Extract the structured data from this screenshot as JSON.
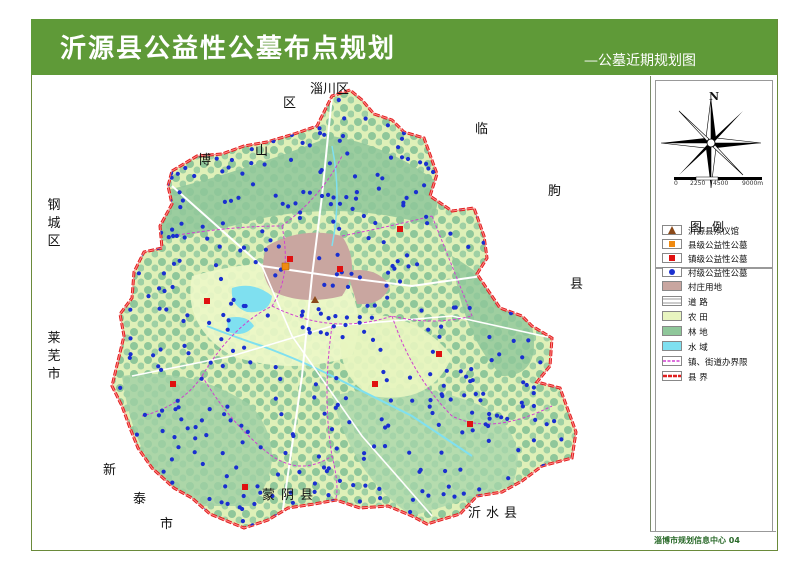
{
  "header": {
    "title": "沂源县公益性公墓布点规划",
    "subtitle": "—公墓近期规划图"
  },
  "neighbors": {
    "zichuan": "淄川区",
    "boshan_1": "博",
    "boshan_2": "山",
    "boshan_3": "区",
    "linqu_1": "临",
    "linqu_2": "朐",
    "linqu_3": "县",
    "gangcheng_1": "钢",
    "gangcheng_2": "城",
    "gangcheng_3": "区",
    "laiwu_1": "莱",
    "laiwu_2": "芜",
    "laiwu_3": "市",
    "xintai_1": "新",
    "xintai_2": "泰",
    "xintai_3": "市",
    "mengyin": "蒙阴县",
    "yishui": "沂水县"
  },
  "compass": {
    "north": "N"
  },
  "scale": {
    "t0": "0",
    "t1": "2250",
    "t2": "4500",
    "t3": "9000m"
  },
  "legend": {
    "title": "图例",
    "items": [
      {
        "label": "沂源县殡仪馆",
        "color": "#8b4a1a",
        "kind": "triangle"
      },
      {
        "label": "县级公益性公墓",
        "color": "#f08a10",
        "kind": "square"
      },
      {
        "label": "镇级公益性公墓",
        "color": "#e01010",
        "kind": "square"
      },
      {
        "label": "村级公益性公墓",
        "color": "#1a2fd0",
        "kind": "dot"
      },
      {
        "label": "村庄用地",
        "color": "#c9a6a0",
        "kind": "fill"
      },
      {
        "label": "道    路",
        "color": "#ffffff",
        "kind": "road"
      },
      {
        "label": "农    田",
        "color": "#e8f5c0",
        "kind": "fill"
      },
      {
        "label": "林    地",
        "color": "#8fc79a",
        "kind": "fill"
      },
      {
        "label": "水    域",
        "color": "#7fe0f0",
        "kind": "fill"
      },
      {
        "label": "镇、街道办界限",
        "color": "#d040d0",
        "kind": "line"
      },
      {
        "label": "县    界",
        "color": "#e02020",
        "kind": "border"
      }
    ]
  },
  "footer": {
    "text": "淄博市规划信息中心 04"
  },
  "colors": {
    "title_bar": "#5f9a38",
    "county_border": "#e02020",
    "town_border": "#d040d0",
    "farmland": "#e8f5c0",
    "forest": "#8fc79a",
    "village": "#c9a6a0",
    "water": "#7fe0f0",
    "village_cemetery": "#1a2fd0",
    "town_cemetery": "#e01010",
    "county_cemetery": "#f08a10",
    "funeral_home": "#8b4a1a"
  },
  "map": {
    "funeral_home_label": "沂源县殡仪馆",
    "county_cemetery_label": "县级公益性公墓",
    "town_cemetery_label": "镇级公益性公墓",
    "village_cemetery_label": "村级公益性公墓"
  }
}
